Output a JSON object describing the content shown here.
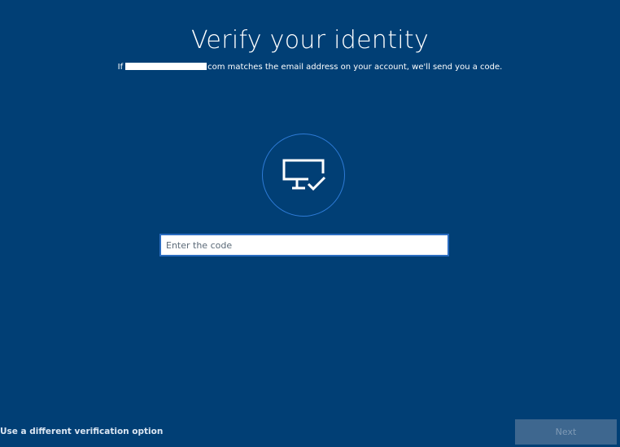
{
  "header": {
    "title": "Verify your identity",
    "subtitle_prefix": "If",
    "subtitle_suffix": "com matches the email address on your account, we'll send you a code."
  },
  "icon": {
    "name": "monitor-check-icon"
  },
  "code_field": {
    "placeholder": "Enter the code",
    "value": ""
  },
  "footer": {
    "alternate_link": "Use a different verification option",
    "next_label": "Next",
    "next_enabled": false
  },
  "colors": {
    "background": "#013f75",
    "accent": "#2e7bd6",
    "button_disabled": "#3e678f"
  }
}
